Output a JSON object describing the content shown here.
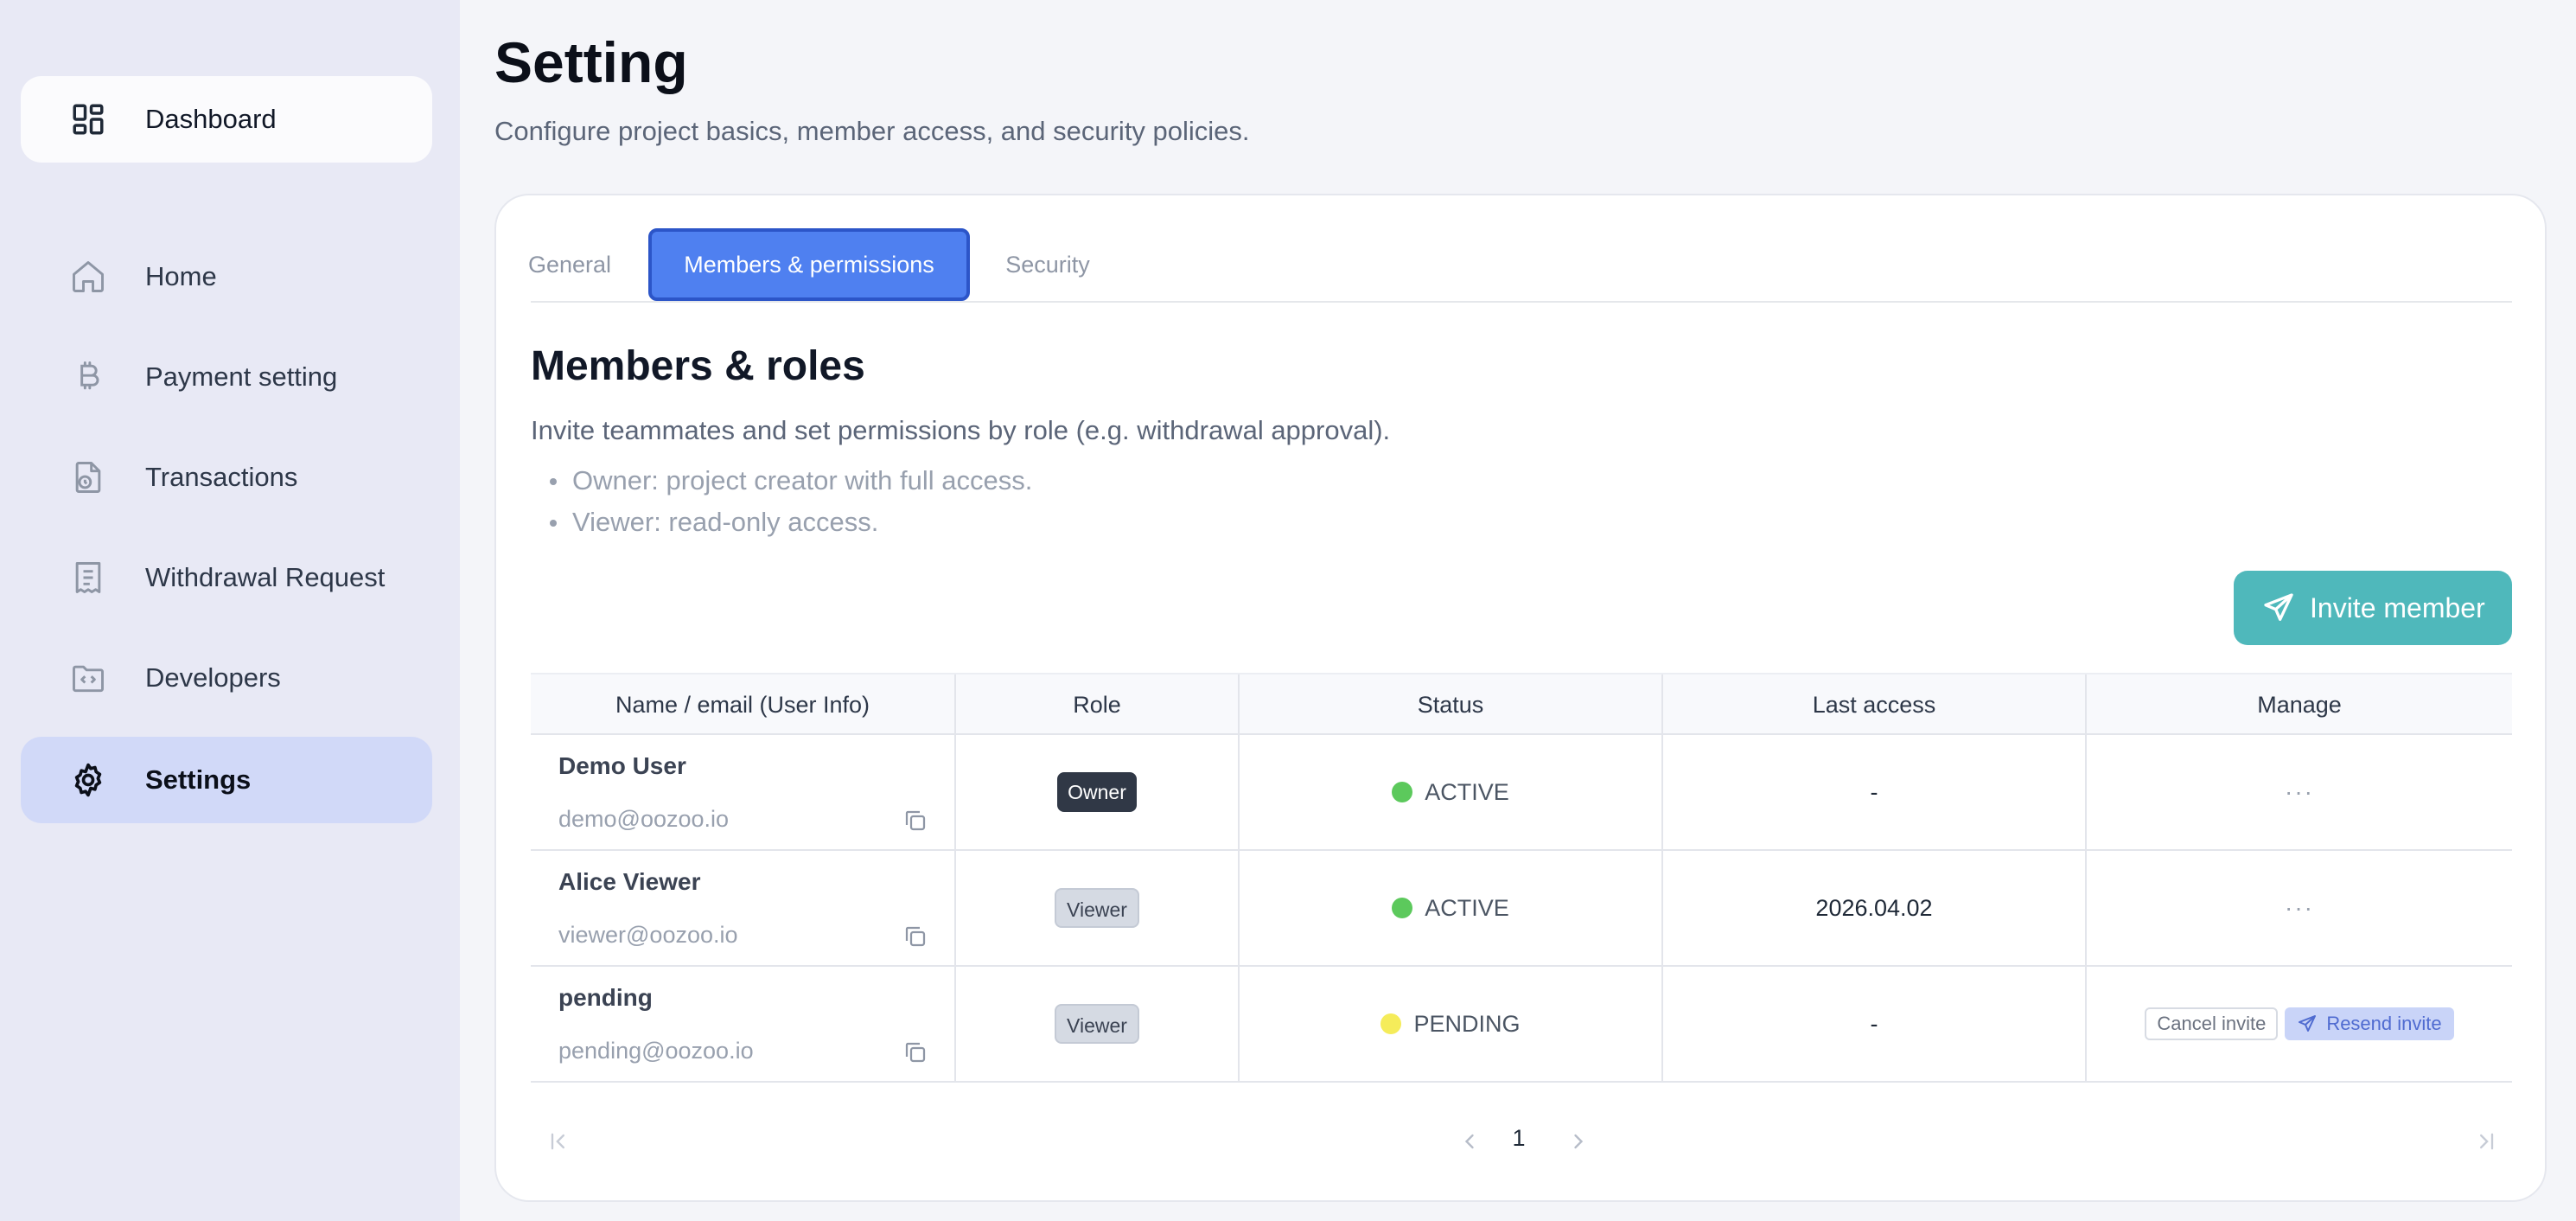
{
  "sidebar": {
    "dashboard": {
      "label": "Dashboard",
      "icon": "dashboard-grid-icon"
    },
    "items": [
      {
        "label": "Home",
        "icon": "home-icon"
      },
      {
        "label": "Payment setting",
        "icon": "bitcoin-icon"
      },
      {
        "label": "Transactions",
        "icon": "document-clock-icon"
      },
      {
        "label": "Withdrawal Request",
        "icon": "receipt-icon"
      },
      {
        "label": "Developers",
        "icon": "code-folder-icon"
      },
      {
        "label": "Settings",
        "icon": "gear-icon",
        "active": true
      }
    ]
  },
  "header": {
    "title": "Setting",
    "subtitle": "Configure project basics, member access, and security policies."
  },
  "tabs": [
    {
      "label": "General"
    },
    {
      "label": "Members & permissions",
      "active": true
    },
    {
      "label": "Security"
    }
  ],
  "members_section": {
    "title": "Members & roles",
    "description": "Invite teammates and set permissions by role (e.g. withdrawal approval).",
    "bullets": [
      "Owner: project creator with full access.",
      "Viewer: read-only access."
    ],
    "invite_button": "Invite member"
  },
  "table": {
    "columns": [
      "Name / email (User Info)",
      "Role",
      "Status",
      "Last access",
      "Manage"
    ],
    "rows": [
      {
        "name": "Demo User",
        "email": "demo@oozoo.io",
        "role": "Owner",
        "status": "ACTIVE",
        "last_access": "-",
        "manage": "···"
      },
      {
        "name": "Alice Viewer",
        "email": "viewer@oozoo.io",
        "role": "Viewer",
        "status": "ACTIVE",
        "last_access": "2026.04.02",
        "manage": "···"
      },
      {
        "name": "pending",
        "email": "pending@oozoo.io",
        "role": "Viewer",
        "status": "PENDING",
        "last_access": "-",
        "cancel_label": "Cancel invite",
        "resend_label": "Resend invite"
      }
    ]
  },
  "pagination": {
    "current_page": "1"
  },
  "colors": {
    "accent": "#4f80f0",
    "invite": "#4fb8bb",
    "active_status": "#5cc95c",
    "pending_status": "#f5ec5a",
    "sidebar_active": "#d1d9f8"
  }
}
